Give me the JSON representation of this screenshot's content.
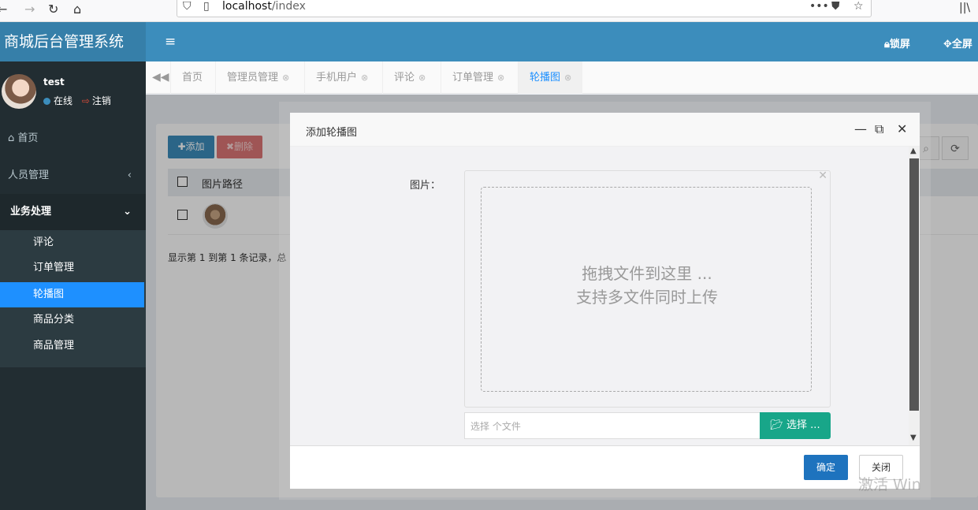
{
  "browser": {
    "url_host": "localhost",
    "url_path": "/index",
    "back_icon": "back-arrow",
    "forward_icon": "forward-arrow",
    "reload_icon": "reload",
    "home_icon": "home",
    "menu_dots": "•••"
  },
  "header": {
    "brand": "商城后台管理系统",
    "lock_label": "锁屏",
    "fullscreen_label": "全屏"
  },
  "user": {
    "name": "test",
    "status": "在线",
    "logout": "注销"
  },
  "sidebar": {
    "home": "首页",
    "personnel": "人员管理",
    "business": "业务处理",
    "items": [
      "评论",
      "订单管理",
      "轮播图",
      "商品分类",
      "商品管理"
    ]
  },
  "tabs": [
    "首页",
    "管理员管理",
    "手机用户",
    "评论",
    "订单管理",
    "轮播图"
  ],
  "table": {
    "add_label": "添加",
    "delete_label": "删除",
    "column_image_path": "图片路径",
    "pager_text": "显示第 1 到第 1 条记录，总"
  },
  "dialog": {
    "title": "添加轮播图",
    "image_label": "图片：",
    "drop_line1": "拖拽文件到这里 ...",
    "drop_line2": "支持多文件同时上传",
    "file_caption": "选择 个文件",
    "browse_label": "选择 ...",
    "ok_label": "确定",
    "close_label": "关闭"
  },
  "watermark": "激活 Win",
  "colors": {
    "header": "#3c8dbc",
    "sidebar": "#222d32",
    "active_menu": "#1e90ff",
    "browse_button": "#18a689",
    "ok_button": "#1e73be"
  }
}
